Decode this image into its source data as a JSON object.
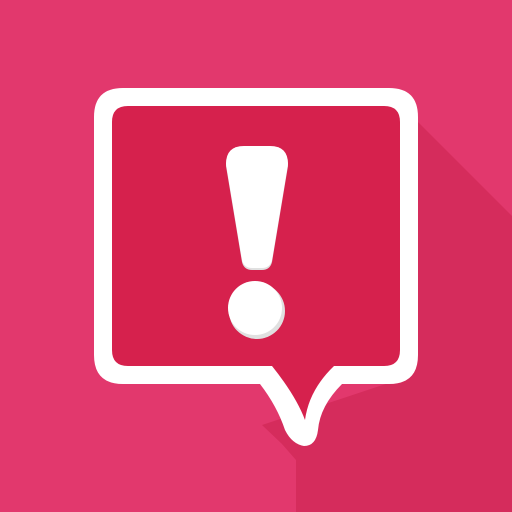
{
  "icon": {
    "name": "alert-speech-bubble-icon",
    "background_color": "#e2386d",
    "shadow_color": "#d52c5c",
    "bubble_fill_color": "#d6214d",
    "outline_color": "#ffffff",
    "glyph_color": "#ffffff",
    "glyph_shadow_color": "#e0e0e0"
  }
}
